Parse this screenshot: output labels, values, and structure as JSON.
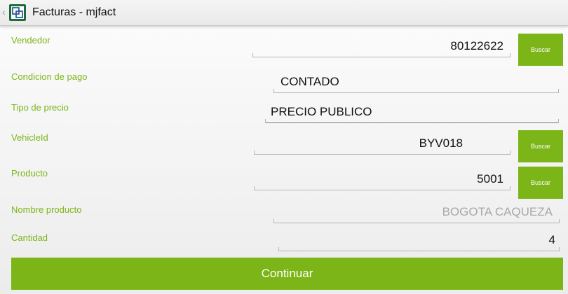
{
  "appbar": {
    "title": "Facturas - mjfact",
    "back": "‹"
  },
  "form": {
    "vendedor": {
      "label": "Vendedor",
      "value": "80122622",
      "button": "Buscar"
    },
    "condicion_pago": {
      "label": "Condicion de pago",
      "value": "CONTADO"
    },
    "tipo_precio": {
      "label": "Tipo de precio",
      "value": "PRECIO PUBLICO"
    },
    "vehicle_id": {
      "label": "VehicleId",
      "value": "BYV018",
      "button": "Buscar"
    },
    "producto": {
      "label": "Producto",
      "value": "5001",
      "button": "Buscar"
    },
    "nombre_producto": {
      "label": "Nombre producto",
      "hint": "BOGOTA CAQUEZA"
    },
    "cantidad": {
      "label": "Cantidad",
      "value": "4"
    }
  },
  "actions": {
    "continue": "Continuar"
  },
  "colors": {
    "accent": "#7cb518",
    "app_icon": "#1b6e3a"
  },
  "icons": {
    "app": "app-logo-icon",
    "back": "back-caret-icon"
  }
}
